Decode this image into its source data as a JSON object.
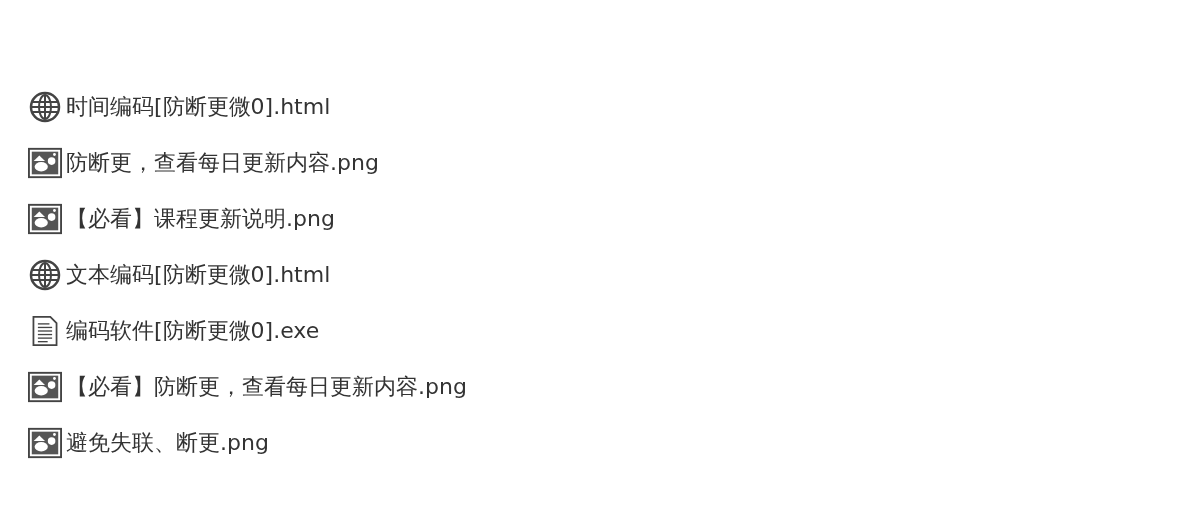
{
  "files": [
    {
      "kind": "web",
      "name": "时间编码[防断更微0].html"
    },
    {
      "kind": "image",
      "name": "防断更，查看每日更新内容.png"
    },
    {
      "kind": "image",
      "name": "【必看】课程更新说明.png"
    },
    {
      "kind": "web",
      "name": "文本编码[防断更微0].html"
    },
    {
      "kind": "document",
      "name": "编码软件[防断更微0].exe"
    },
    {
      "kind": "image",
      "name": "【必看】防断更，查看每日更新内容.png"
    },
    {
      "kind": "image",
      "name": "避免失联、断更.png"
    }
  ]
}
